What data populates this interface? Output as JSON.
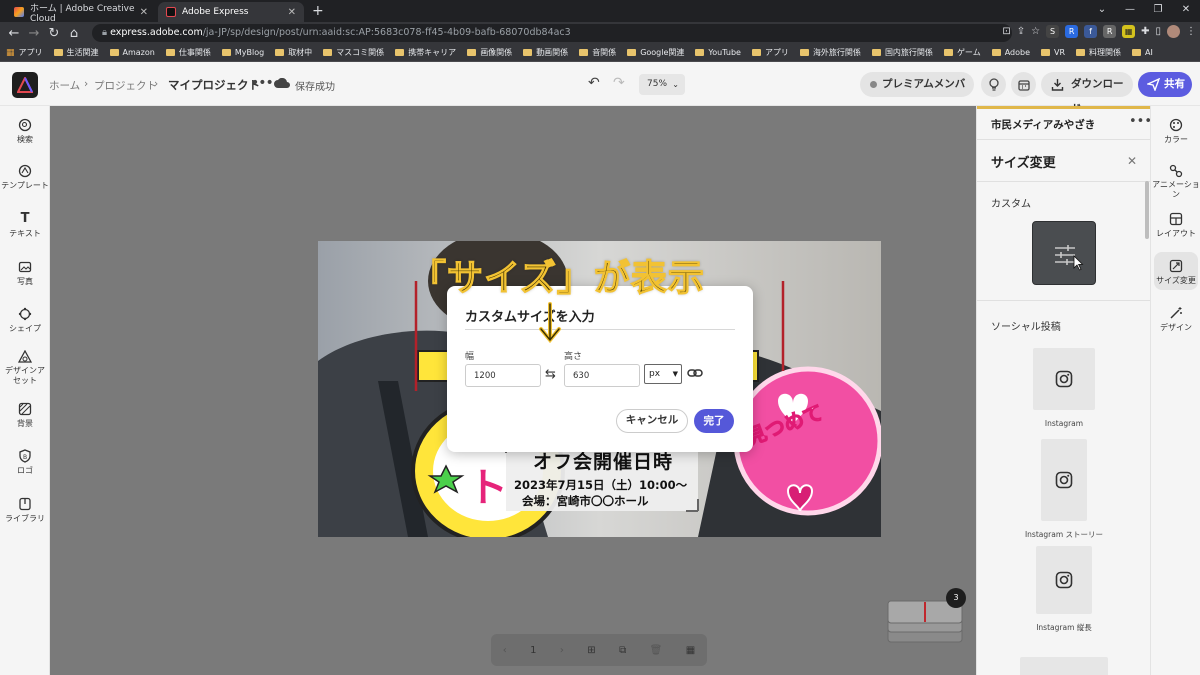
{
  "browser": {
    "tabs": [
      {
        "title": "ホーム | Adobe Creative Cloud",
        "active": false
      },
      {
        "title": "Adobe Express",
        "active": true
      }
    ],
    "url_host": "express.adobe.com",
    "url_path": "/ja-JP/sp/design/post/urn:aaid:sc:AP:5683c078-ff45-4b09-bafb-68070db84ac3",
    "bookmarks": [
      "アプリ",
      "生活関連",
      "Amazon",
      "仕事関係",
      "MyBlog",
      "取材中",
      "マスコミ関係",
      "携帯キャリア",
      "画像関係",
      "動画関係",
      "音関係",
      "Google関連",
      "YouTube",
      "アプリ",
      "海外旅行関係",
      "国内旅行関係",
      "ゲーム",
      "Adobe",
      "VR",
      "料理関係",
      "AI"
    ]
  },
  "header": {
    "crumb_home": "ホーム",
    "crumb_projects": "プロジェクト",
    "project_title": "マイプロジェクト",
    "save_status": "保存成功",
    "zoom": "75%",
    "premium_label": "プレミアムメンバー",
    "download_label": "ダウンロード",
    "share_label": "共有"
  },
  "left_rail": [
    "検索",
    "テンプレート",
    "テキスト",
    "写真",
    "シェイプ",
    "デザインアセット",
    "背景",
    "ロゴ",
    "ライブラリ"
  ],
  "right_rail": [
    "カラー",
    "アニメーション",
    "レイアウト",
    "サイズ変更",
    "デザイン"
  ],
  "right_panel": {
    "account": "市民メディアみやざき",
    "heading": "サイズ変更",
    "custom_label": "カスタム",
    "social_label": "ソーシャル投稿",
    "items": [
      "Instagram",
      "Instagram ストーリー",
      "Instagram 縦長"
    ]
  },
  "dialog": {
    "title": "カスタムサイズを入力",
    "width_label": "幅",
    "height_label": "高さ",
    "width_value": "1200",
    "height_value": "630",
    "unit": "px",
    "cancel_label": "キャンセル",
    "done_label": "完了"
  },
  "artboard": {
    "line1": "オフ会開催日時",
    "line2": "2023年7月15日（土）10:00〜",
    "line3": "会場：宮崎市〇〇ホール",
    "fan_text": "見つめて"
  },
  "annotation": "「サイズ」が表示",
  "pager": {
    "page": "1",
    "count": "3"
  }
}
